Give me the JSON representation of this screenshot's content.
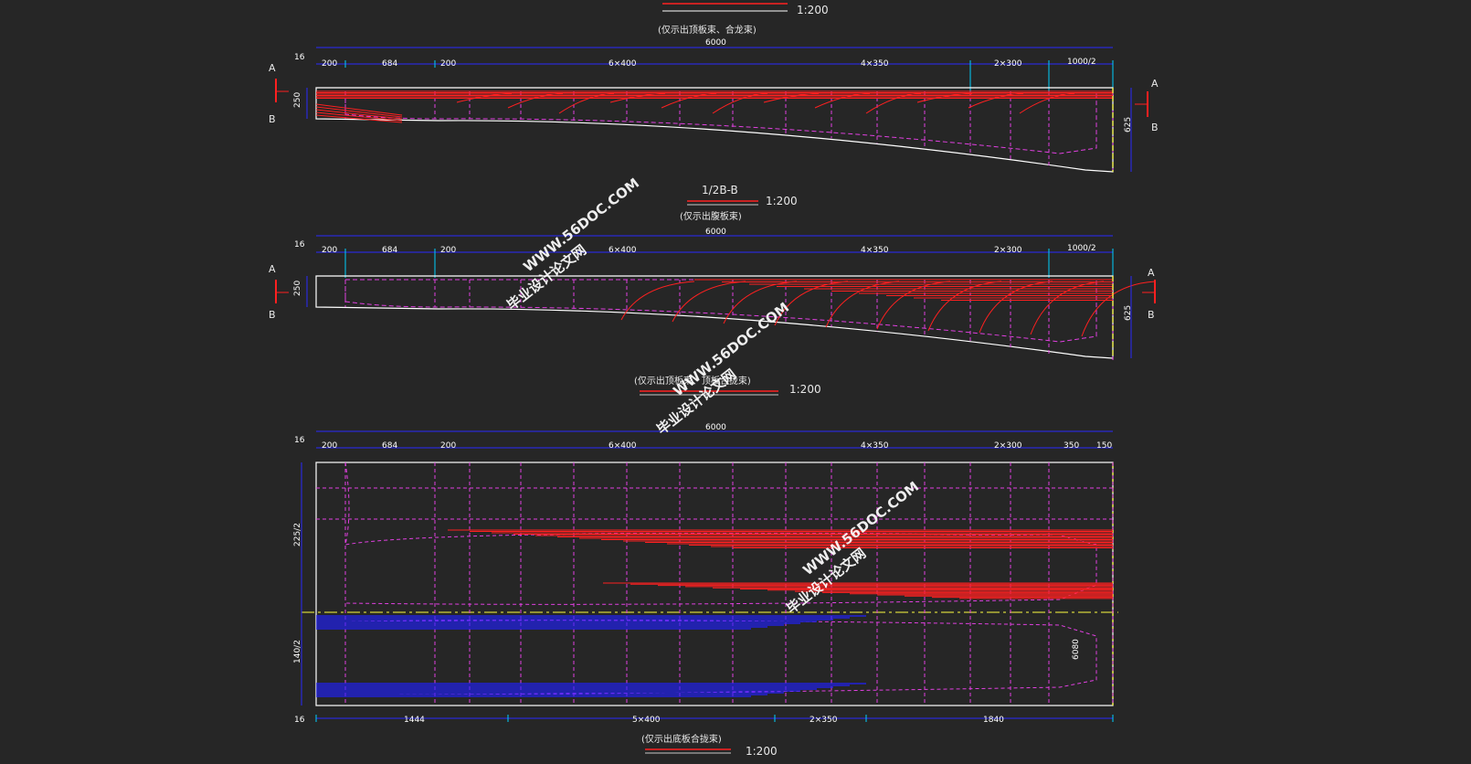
{
  "views": [
    {
      "id": "view1",
      "title": "",
      "note": "(仅示出顶板束、合龙束)",
      "scale": "1:200",
      "total": "6000",
      "seg_labels": [
        "16",
        "200",
        "684",
        "200",
        "6×400",
        "4×350",
        "2×300",
        "1000/2"
      ],
      "heights": [
        "250",
        "625"
      ],
      "section_marks": [
        "A",
        "B",
        "A",
        "B"
      ]
    },
    {
      "id": "view2",
      "title": "1/2B-B",
      "note": "(仅示出腹板束)",
      "scale": "1:200",
      "total": "6000",
      "seg_labels": [
        "16",
        "200",
        "684",
        "200",
        "6×400",
        "4×350",
        "2×300",
        "1000/2"
      ],
      "heights": [
        "250",
        "625"
      ],
      "section_marks": [
        "A",
        "B",
        "A",
        "B"
      ]
    },
    {
      "id": "view3",
      "title": "",
      "note": "(仅示出顶板束、顶板合拢束)",
      "scale": "1:200",
      "total": "6000",
      "seg_labels": [
        "16",
        "200",
        "684",
        "200",
        "6×400",
        "4×350",
        "2×300",
        "350",
        "150"
      ],
      "heights": [
        "225/2",
        "140/2"
      ],
      "bottom_labels": [
        "16",
        "1444",
        "5×400",
        "2×350",
        "1840"
      ],
      "side_label": "6080"
    }
  ],
  "bottom_note": "(仅示出底板合拢束)",
  "bottom_scale": "1:200",
  "watermark": {
    "domain": "WWW.56DOC.COM",
    "name": "毕业设计论文网"
  },
  "colors": {
    "background": "#262626",
    "outline": "#ffffff",
    "dimension": "#2b2bff",
    "centerline": "#e040e0",
    "tendon_top": "#ff2020",
    "tendon_bottom": "#2020ff",
    "dim_tick": "#00d0ff",
    "axis": "#ffff40"
  }
}
